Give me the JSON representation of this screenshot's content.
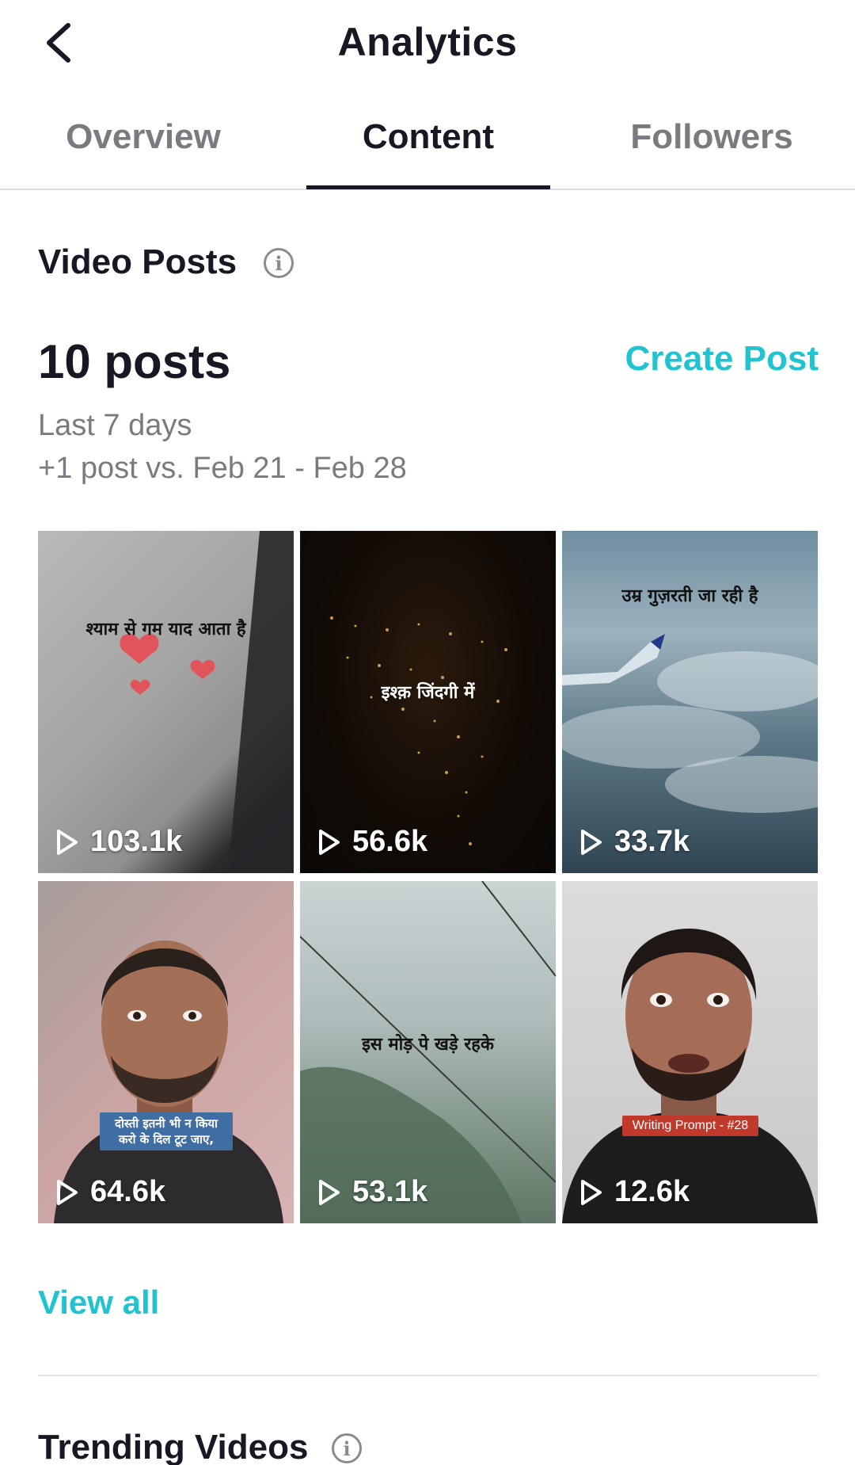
{
  "header": {
    "title": "Analytics",
    "back_icon": "chevron-left-icon"
  },
  "tabs": [
    {
      "label": "Overview",
      "active": false
    },
    {
      "label": "Content",
      "active": true
    },
    {
      "label": "Followers",
      "active": false
    }
  ],
  "video_posts": {
    "section_title": "Video Posts",
    "count_label": "10 posts",
    "create_post_label": "Create Post",
    "period_label": "Last 7 days",
    "comparison_label": "+1 post vs. Feb 21 - Feb 28",
    "videos": [
      {
        "views": "103.1k",
        "overlay_text": "श्याम से गम याद आता है"
      },
      {
        "views": "56.6k",
        "overlay_text": "इश्क़ जिंदगी में"
      },
      {
        "views": "33.7k",
        "overlay_text": "उम्र गुज़रती जा रही है"
      },
      {
        "views": "64.6k",
        "overlay_text": "दोस्ती इतनी भी न किया करो के दिल टूट जाए,"
      },
      {
        "views": "53.1k",
        "overlay_text": "इस मोड़ पे खड़े रहके"
      },
      {
        "views": "12.6k",
        "overlay_text": "Writing Prompt - #28"
      }
    ],
    "view_all_label": "View all"
  },
  "trending": {
    "section_title": "Trending Videos"
  },
  "colors": {
    "accent": "#20c4d0",
    "text": "#161823",
    "muted": "#7a7b80"
  }
}
